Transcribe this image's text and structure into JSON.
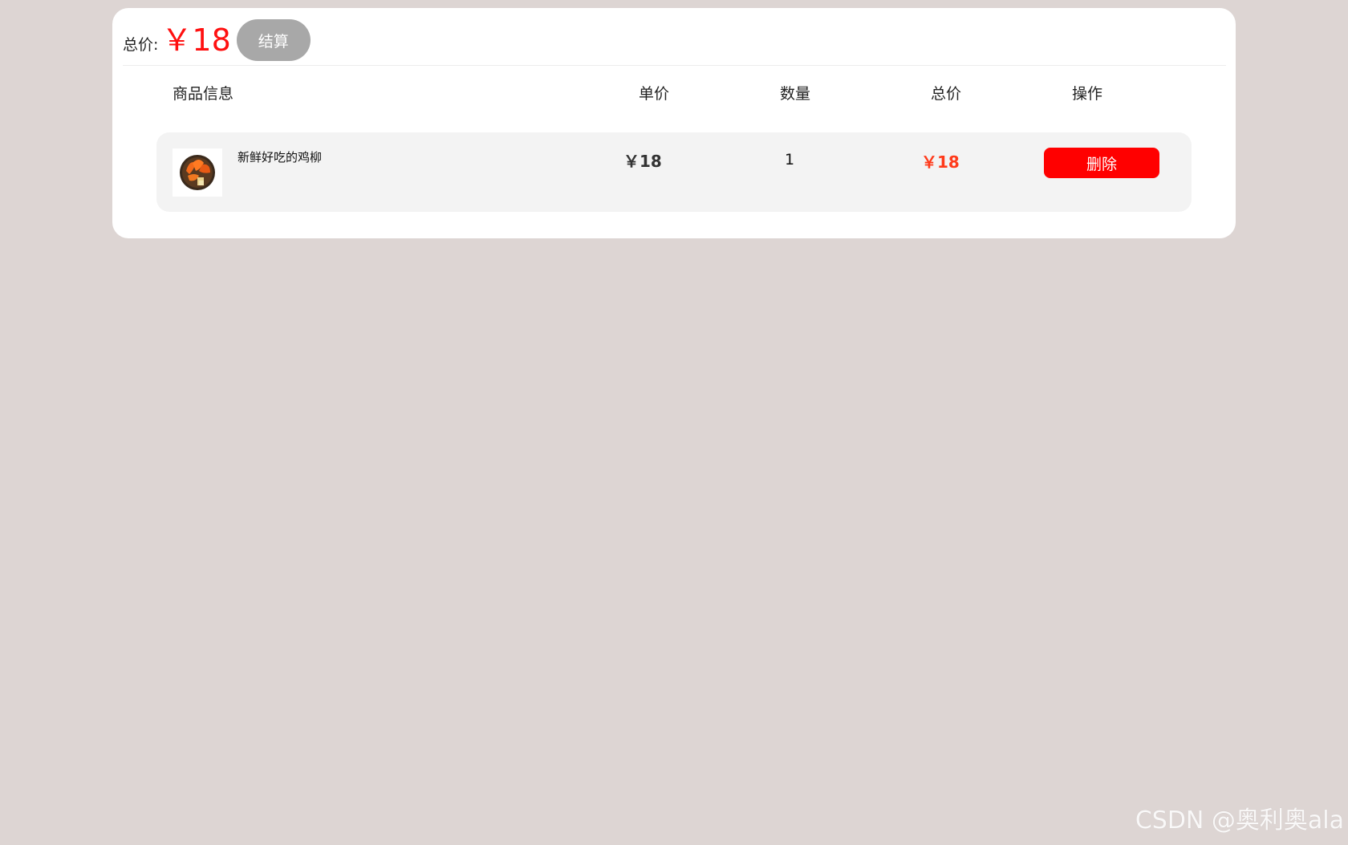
{
  "summary": {
    "total_label": "总价:",
    "total_amount": "￥18",
    "checkout_label": "结算"
  },
  "table": {
    "headers": {
      "info": "商品信息",
      "price": "单价",
      "quantity": "数量",
      "total": "总价",
      "operation": "操作"
    },
    "items": [
      {
        "name": "新鲜好吃的鸡柳",
        "unit_price": "￥18",
        "quantity": "1",
        "total": "￥18",
        "delete_label": "删除",
        "thumbnail_icon": "chicken-strips-image"
      }
    ]
  },
  "watermark": "CSDN @奥利奥ala",
  "colors": {
    "background": "#ddd5d3",
    "price_red": "#ff1010",
    "row_total": "#ff3a1a",
    "delete_button": "#ff0000",
    "checkout_button": "#a8a8a8"
  }
}
